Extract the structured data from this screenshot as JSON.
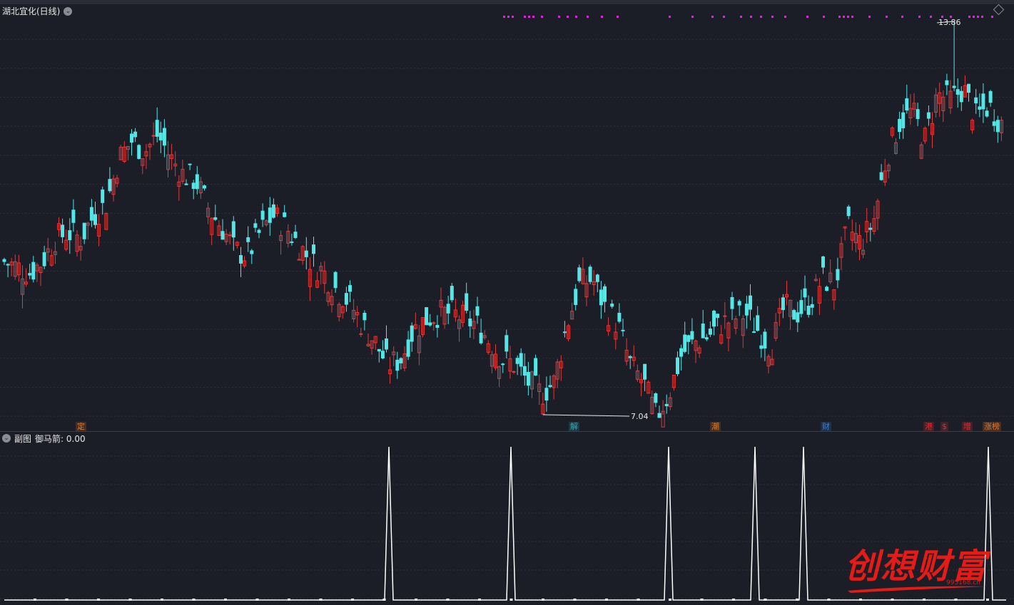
{
  "main_chart": {
    "title": "湖北宜化(日线)",
    "high_label": "13.86",
    "low_label": "7.04"
  },
  "sub_chart": {
    "label": "副图",
    "indicator": "御马箭: 0.00"
  },
  "markers": [
    {
      "text": "定",
      "color": "#e07a2a"
    },
    {
      "text": "解",
      "color": "#3aa6b0"
    },
    {
      "text": "潮",
      "color": "#e07a2a"
    },
    {
      "text": "财",
      "color": "#3a7fd0"
    },
    {
      "text": "港",
      "color": "#e03030"
    },
    {
      "text": "$",
      "color": "#e03030"
    },
    {
      "text": "增",
      "color": "#e03030"
    },
    {
      "text": "涨榜",
      "color": "#e07a2a"
    }
  ],
  "watermark": {
    "text": "创想财富",
    "url": "995168.cn"
  },
  "colors": {
    "up": "#e23b3b",
    "down": "#53e7e7",
    "signal_dots": "#d22cd2",
    "indicator_line": "#ffffff",
    "grid": "#2f3240"
  },
  "chart_data": {
    "type": "candlestick",
    "title": "湖北宜化(日线)",
    "price_high": 13.86,
    "price_low": 7.04,
    "closes": [
      9.7,
      9.6,
      9.5,
      9.7,
      10.1,
      10.2,
      10.1,
      10.5,
      10.7,
      11.5,
      11.8,
      11.6,
      11.9,
      11.5,
      11.2,
      11.1,
      10.6,
      10.3,
      9.9,
      9.8,
      10.2,
      10.5,
      10.3,
      10.0,
      9.7,
      9.5,
      9.2,
      9.0,
      8.6,
      8.3,
      7.9,
      8.0,
      8.5,
      8.7,
      8.8,
      8.8,
      8.7,
      8.6,
      8.3,
      8.0,
      7.9,
      7.6,
      7.4,
      7.6,
      8.6,
      9.3,
      9.4,
      8.9,
      8.6,
      7.9,
      7.6,
      7.0,
      7.4,
      8.1,
      8.3,
      8.4,
      8.6,
      8.7,
      8.8,
      8.5,
      8.2,
      8.9,
      8.8,
      9.0,
      9.4,
      9.3,
      10.3,
      10.0,
      10.4,
      11.5,
      12.1,
      12.3,
      11.8,
      12.6,
      12.5,
      12.7,
      12.2,
      12.4,
      12.1
    ],
    "indicator": {
      "name": "御马箭",
      "value": 0.0,
      "spike_indices": [
        30,
        42,
        55,
        63,
        67,
        78
      ]
    },
    "annotations": [
      {
        "type": "max",
        "value": 13.86
      },
      {
        "type": "min",
        "value": 7.04
      }
    ]
  }
}
